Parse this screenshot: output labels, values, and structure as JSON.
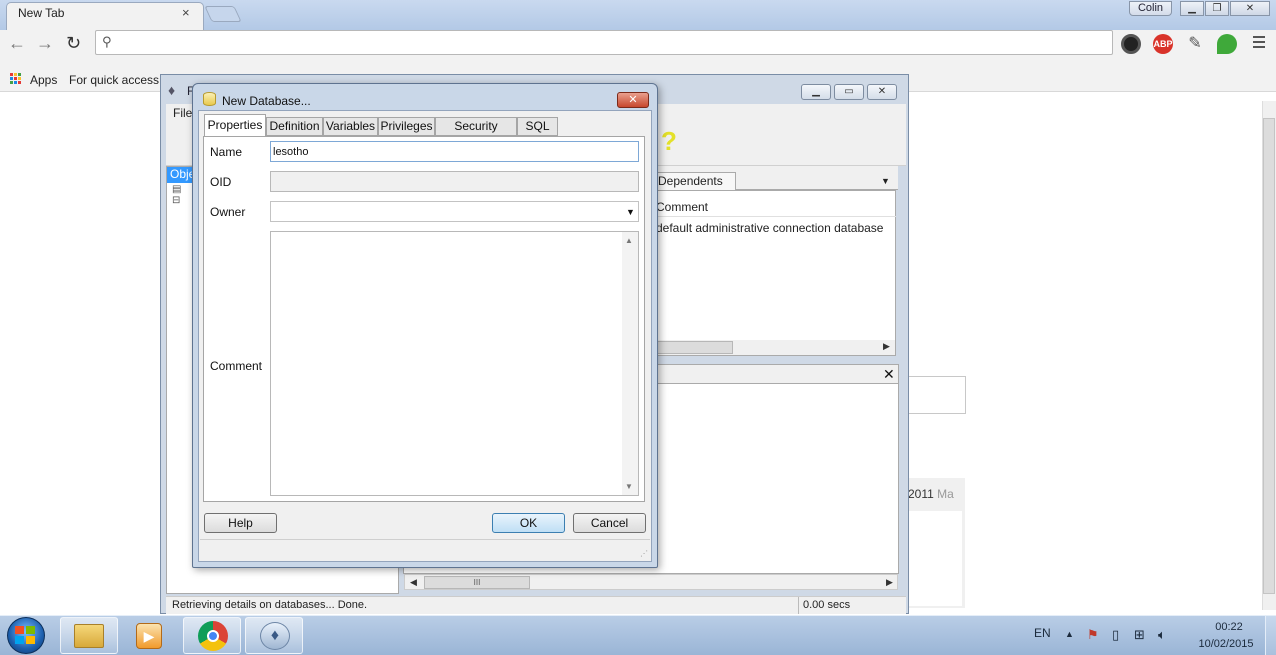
{
  "browser": {
    "tab_title": "New Tab",
    "tab_close": "×",
    "user_name": "Colin",
    "omnibox_value": "",
    "bookmarks": {
      "apps_label": "Apps",
      "quick_access_label": "For quick access,"
    },
    "extensions": [
      "camera-icon",
      "adblock-plus-icon",
      "eyedropper-icon",
      "evernote-icon"
    ],
    "abp_label": "ABP"
  },
  "background_page": {
    "year_text": "2011",
    "year_suffix": "Ma"
  },
  "pgadmin": {
    "title_fragment": "F",
    "menu_file": "File",
    "tree_header": "Obje",
    "tab_dependents": "Dependents",
    "column_comment": "Comment",
    "row_comment": "default administrative connection database",
    "scroll_thumb_grip": "III",
    "status_text": "Retrieving details on databases... Done.",
    "status_time": "0.00 secs"
  },
  "dialog": {
    "title": "New Database...",
    "close_label": "✕",
    "tabs": [
      {
        "label": "Properties",
        "active": true
      },
      {
        "label": "Definition",
        "active": false
      },
      {
        "label": "Variables",
        "active": false
      },
      {
        "label": "Privileges",
        "active": false
      },
      {
        "label": "Security Labels",
        "active": false
      },
      {
        "label": "SQL",
        "active": false
      }
    ],
    "fields": {
      "name_label": "Name",
      "name_value": "lesotho",
      "oid_label": "OID",
      "oid_value": "",
      "owner_label": "Owner",
      "owner_value": "",
      "comment_label": "Comment",
      "comment_value": ""
    },
    "buttons": {
      "help": "Help",
      "ok": "OK",
      "cancel": "Cancel"
    }
  },
  "taskbar": {
    "language": "EN",
    "time": "00:22",
    "date": "10/02/2015"
  }
}
